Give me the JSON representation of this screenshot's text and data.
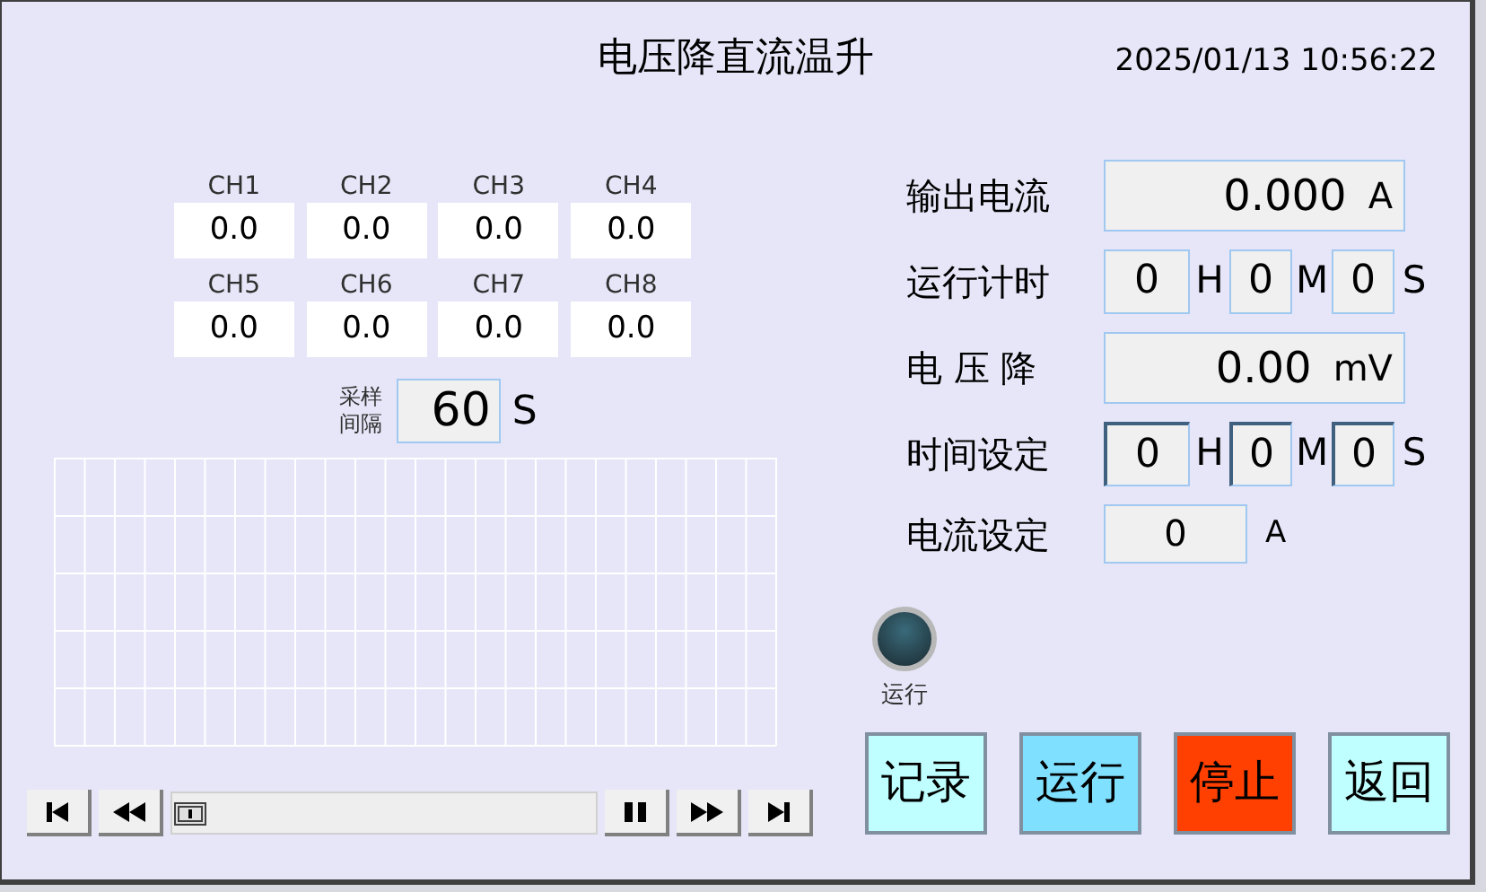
{
  "title": "电压降直流温升",
  "datetime": "2025/01/13 10:56:22",
  "channels": [
    {
      "label": "CH1",
      "value": "0.0"
    },
    {
      "label": "CH2",
      "value": "0.0"
    },
    {
      "label": "CH3",
      "value": "0.0"
    },
    {
      "label": "CH4",
      "value": "0.0"
    },
    {
      "label": "CH5",
      "value": "0.0"
    },
    {
      "label": "CH6",
      "value": "0.0"
    },
    {
      "label": "CH7",
      "value": "0.0"
    },
    {
      "label": "CH8",
      "value": "0.0"
    }
  ],
  "sampling": {
    "label": "采样间隔",
    "value": "60",
    "unit": "S"
  },
  "readings": [
    {
      "kind": "display",
      "label": "输出电流",
      "value": "0.000",
      "unit": "A"
    },
    {
      "kind": "timer",
      "label": "运行计时",
      "parts": [
        {
          "value": "0",
          "unit": "H"
        },
        {
          "value": "0",
          "unit": "M"
        },
        {
          "value": "0",
          "unit": "S"
        }
      ]
    },
    {
      "kind": "display",
      "label": "电 压 降",
      "value": "0.00",
      "unit": "mV"
    },
    {
      "kind": "time_input",
      "label": "时间设定",
      "parts": [
        {
          "value": "0",
          "unit": "H"
        },
        {
          "value": "0",
          "unit": "M"
        },
        {
          "value": "0",
          "unit": "S"
        }
      ]
    },
    {
      "kind": "setting",
      "label": "电流设定",
      "value": "0",
      "unit": "A"
    }
  ],
  "indicator": {
    "label": "运行",
    "on": false
  },
  "buttons": [
    {
      "label": "记录",
      "color": "#c0ffff"
    },
    {
      "label": "运行",
      "color": "#80e0ff"
    },
    {
      "label": "停止",
      "color": "#ff4000"
    },
    {
      "label": "返回",
      "color": "#c0ffff"
    }
  ]
}
